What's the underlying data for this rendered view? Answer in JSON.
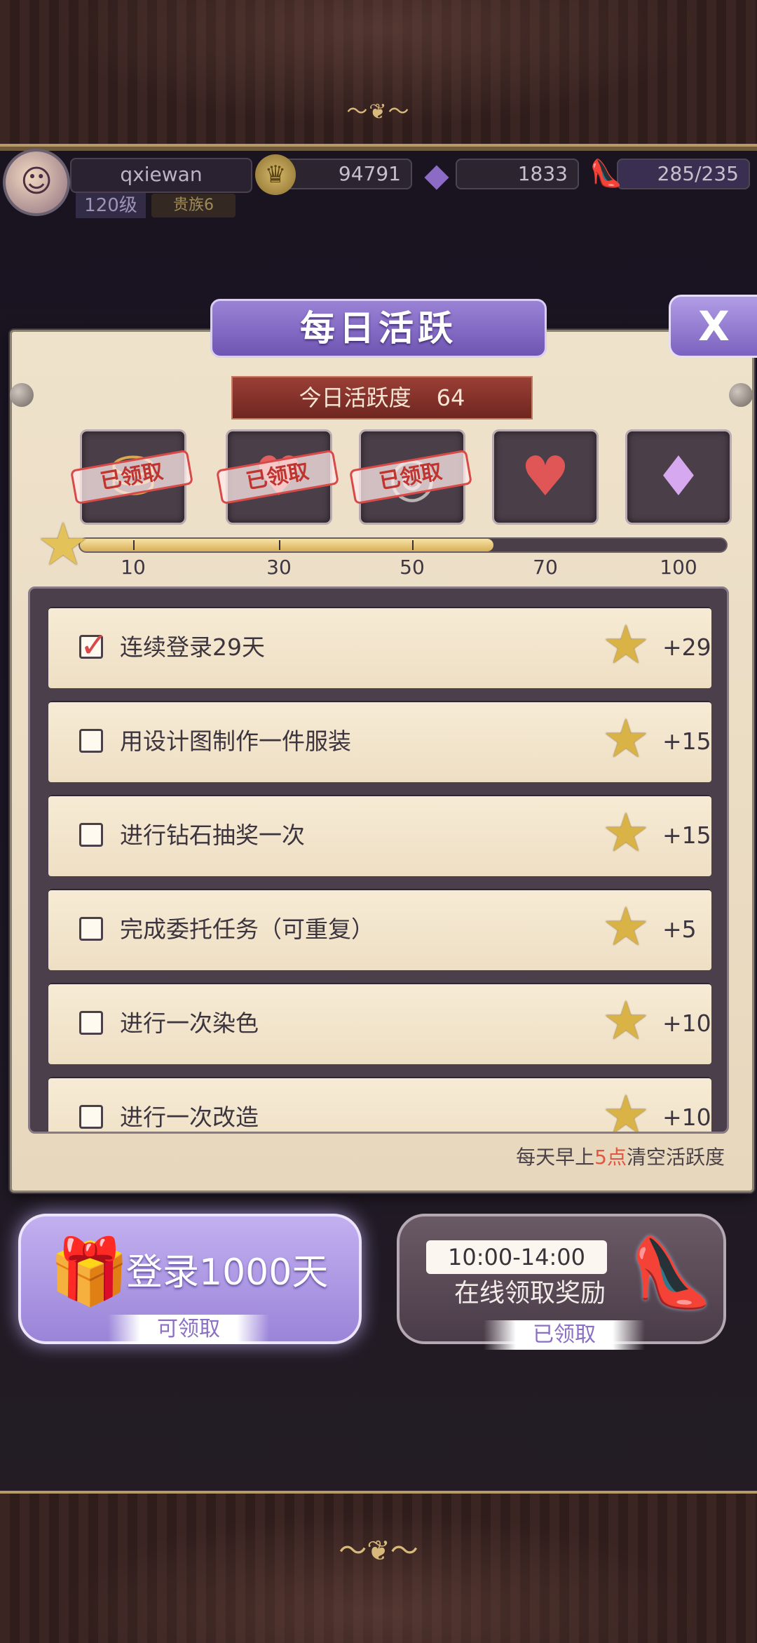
{
  "hud": {
    "username": "qxiewan",
    "level": "120级",
    "title_tag": "贵族6",
    "gold": "94791",
    "gems": "1833",
    "stamina": "285/235",
    "plus": "+"
  },
  "panel": {
    "title": "每日活跃",
    "close": "X",
    "activity_label": "今日活跃度",
    "activity_value": "64",
    "progress": 64,
    "progress_max": 100,
    "milestones": [
      {
        "value": "10",
        "icon": "coins-icon",
        "claimed": true
      },
      {
        "value": "30",
        "icon": "heart-icon",
        "claimed": true
      },
      {
        "value": "50",
        "icon": "coin-icon",
        "claimed": true
      },
      {
        "value": "70",
        "icon": "heart-icon",
        "claimed": false
      },
      {
        "value": "100",
        "icon": "diamond-icon",
        "claimed": false
      }
    ],
    "claimed_stamp": "已领取",
    "tasks": [
      {
        "label": "连续登录29天",
        "points": "+29",
        "checked": true
      },
      {
        "label": "用设计图制作一件服装",
        "points": "+15",
        "checked": false
      },
      {
        "label": "进行钻石抽奖一次",
        "points": "+15",
        "checked": false
      },
      {
        "label": "完成委托任务（可重复）",
        "points": "+5",
        "checked": false
      },
      {
        "label": "进行一次染色",
        "points": "+10",
        "checked": false
      },
      {
        "label": "进行一次改造",
        "points": "+10",
        "checked": false
      }
    ],
    "reset_note_pre": "每天早上",
    "reset_note_hi": "5点",
    "reset_note_post": "清空活跃度"
  },
  "bottom": {
    "login_label": "登录1000天",
    "login_status": "可领取",
    "online_time": "10:00-14:00",
    "online_label": "在线领取奖励",
    "online_status": "已领取"
  },
  "colors": {
    "accent_purple": "#8a6fc4",
    "stamp_red": "#c03430",
    "highlight": "#e2563e"
  }
}
